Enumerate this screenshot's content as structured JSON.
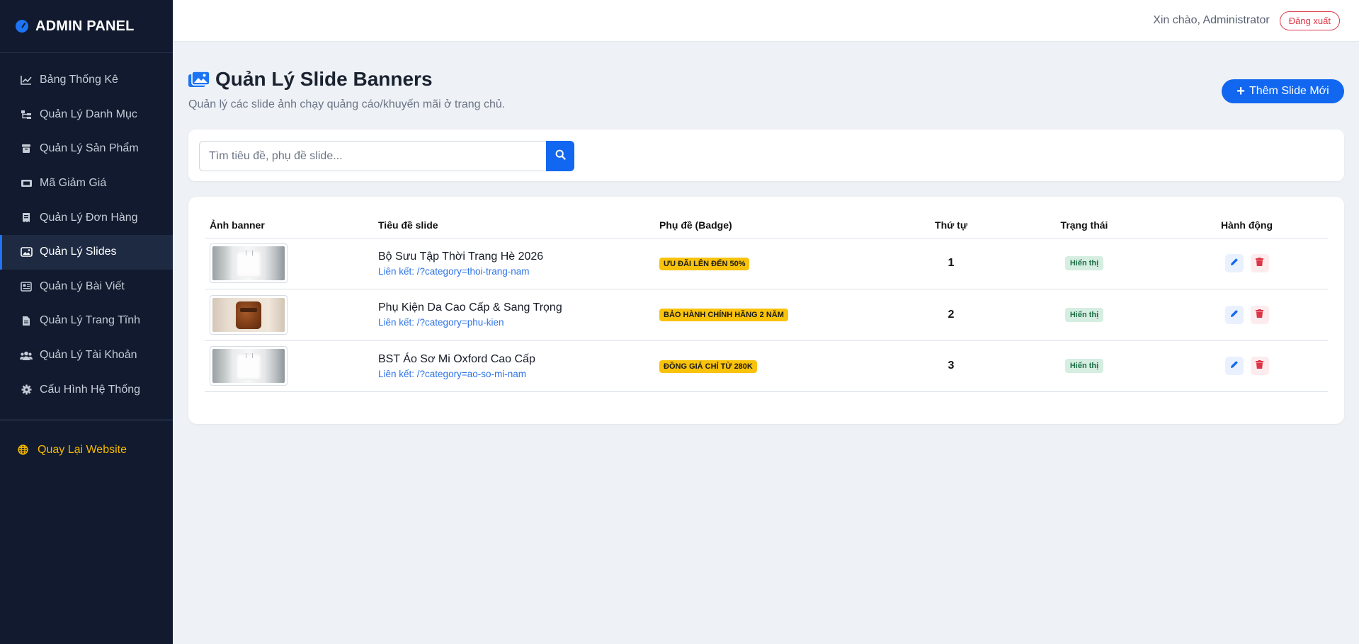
{
  "brand": {
    "title": "ADMIN PANEL",
    "icon": "dashboard-icon"
  },
  "sidebar": {
    "items": [
      {
        "label": "Bảng Thống Kê",
        "icon": "chart-line-icon"
      },
      {
        "label": "Quản Lý Danh Mục",
        "icon": "sitemap-icon"
      },
      {
        "label": "Quản Lý Sản Phẩm",
        "icon": "box-icon"
      },
      {
        "label": "Mã Giảm Giá",
        "icon": "ticket-icon"
      },
      {
        "label": "Quản Lý Đơn Hàng",
        "icon": "receipt-icon"
      },
      {
        "label": "Quản Lý Slides",
        "icon": "images-icon",
        "active": true
      },
      {
        "label": "Quản Lý Bài Viết",
        "icon": "newspaper-icon"
      },
      {
        "label": "Quản Lý Trang Tĩnh",
        "icon": "file-icon"
      },
      {
        "label": "Quản Lý Tài Khoản",
        "icon": "users-icon"
      },
      {
        "label": "Cấu Hình Hệ Thống",
        "icon": "gear-icon"
      }
    ],
    "back_label": "Quay Lại Website"
  },
  "topbar": {
    "greeting": "Xin chào, Administrator",
    "logout_label": "Đăng xuất"
  },
  "page": {
    "title": "Quản Lý Slide Banners",
    "subtitle": "Quản lý các slide ảnh chạy quảng cáo/khuyến mãi ở trang chủ.",
    "add_label": "Thêm Slide Mới"
  },
  "search": {
    "placeholder": "Tìm tiêu đề, phụ đề slide..."
  },
  "table": {
    "headers": [
      "Ảnh banner",
      "Tiêu đề slide",
      "Phụ đề (Badge)",
      "Thứ tự",
      "Trạng thái",
      "Hành động"
    ],
    "rows": [
      {
        "image": "shirt",
        "title": "Bộ Sưu Tập Thời Trang Hè 2026",
        "link": "Liên kết: /?category=thoi-trang-nam",
        "badge": "ƯU ĐÃI LÊN ĐẾN 50%",
        "order": "1",
        "status": "Hiển thị"
      },
      {
        "image": "bag",
        "title": "Phụ Kiện Da Cao Cấp & Sang Trọng",
        "link": "Liên kết: /?category=phu-kien",
        "badge": "BẢO HÀNH CHÍNH HÃNG 2 NĂM",
        "order": "2",
        "status": "Hiển thị"
      },
      {
        "image": "shirt",
        "title": "BST Áo Sơ Mi Oxford Cao Cấp",
        "link": "Liên kết: /?category=ao-so-mi-nam",
        "badge": "ĐỒNG GIÁ CHỈ TỪ 280K",
        "order": "3",
        "status": "Hiển thị"
      }
    ]
  },
  "colors": {
    "sidebar_bg": "#111a2e",
    "primary": "#1167f0",
    "badge": "#f9c20b",
    "danger": "#dc3545",
    "back_link": "#f5b800"
  }
}
